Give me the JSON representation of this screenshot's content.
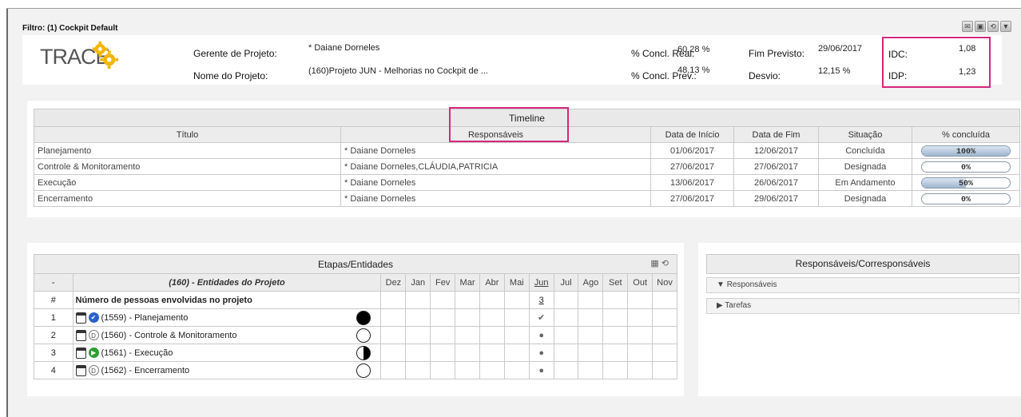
{
  "filter": {
    "title": "Filtro: (1) Cockpit Default"
  },
  "header": {
    "logo_text": "TRACE",
    "gerente_label": "Gerente de Projeto:",
    "gerente_value": "* Daiane Dorneles",
    "nome_label": "Nome do Projeto:",
    "nome_value": "(160)Projeto JUN - Melhorias no Cockpit de ...",
    "concl_real_label": "% Concl. Real:",
    "concl_real_value": "60,28 %",
    "concl_prev_label": "% Concl. Prev.:",
    "concl_prev_value": "48,13 %",
    "fim_label": "Fim Previsto:",
    "fim_value": "29/06/2017",
    "desvio_label": "Desvio:",
    "desvio_value": "12,15 %",
    "idc_label": "IDC:",
    "idc_value": "1,08",
    "idp_label": "IDP:",
    "idp_value": "1,23"
  },
  "timeline": {
    "title": "Timeline",
    "columns": [
      "Título",
      "Responsáveis",
      "Data de Início",
      "Data de Fim",
      "Situação",
      "% concluída"
    ],
    "rows": [
      {
        "titulo": "Planejamento",
        "responsaveis": "* Daiane Dorneles",
        "inicio": "01/06/2017",
        "fim": "12/06/2017",
        "situacao": "Concluída",
        "pct_label": "100%",
        "pct": 100
      },
      {
        "titulo": "Controle & Monitoramento",
        "responsaveis": "* Daiane Dorneles,CLÁUDIA,PATRICIA",
        "inicio": "27/06/2017",
        "fim": "27/06/2017",
        "situacao": "Designada",
        "pct_label": "0%",
        "pct": 0
      },
      {
        "titulo": "Execução",
        "responsaveis": "* Daiane Dorneles",
        "inicio": "13/06/2017",
        "fim": "26/06/2017",
        "situacao": "Em Andamento",
        "pct_label": "50%",
        "pct": 50
      },
      {
        "titulo": "Encerramento",
        "responsaveis": "* Daiane Dorneles",
        "inicio": "27/06/2017",
        "fim": "29/06/2017",
        "situacao": "Designada",
        "pct_label": "0%",
        "pct": 0
      }
    ]
  },
  "etapas": {
    "title": "Etapas/Entidades",
    "dash": "-",
    "entity_header": "(160) - Entidades do Projeto",
    "months": [
      "Dez",
      "Jan",
      "Fev",
      "Mar",
      "Abr",
      "Mai",
      "Jun",
      "Jul",
      "Ago",
      "Set",
      "Out",
      "Nov"
    ],
    "hash": "#",
    "pessoas_label": "Número de pessoas envolvidas no projeto",
    "pessoas_jun": "3",
    "rows": [
      {
        "num": "1",
        "label": "(1559) - Planejamento",
        "status_icon": "check-circle-icon",
        "circle": "full",
        "jun_mark": "✔"
      },
      {
        "num": "2",
        "label": "(1560) - Controle & Monitoramento",
        "status_icon": "designated-icon",
        "circle": "empty",
        "jun_mark": "●"
      },
      {
        "num": "3",
        "label": "(1561) - Execução",
        "status_icon": "play-icon",
        "circle": "half",
        "jun_mark": "●"
      },
      {
        "num": "4",
        "label": "(1562) - Encerramento",
        "status_icon": "designated-icon",
        "circle": "empty",
        "jun_mark": "●"
      }
    ]
  },
  "responsaveis": {
    "title": "Responsáveis/Corresponsáveis",
    "items": [
      {
        "label": "Responsáveis",
        "expanded": true
      },
      {
        "label": "Tarefas",
        "expanded": false
      }
    ]
  },
  "colors": {
    "highlight": "#d6287e",
    "bar_fill": "#9eb6cd",
    "check_blue": "#2a62c9",
    "play_green": "#2e9e33"
  }
}
